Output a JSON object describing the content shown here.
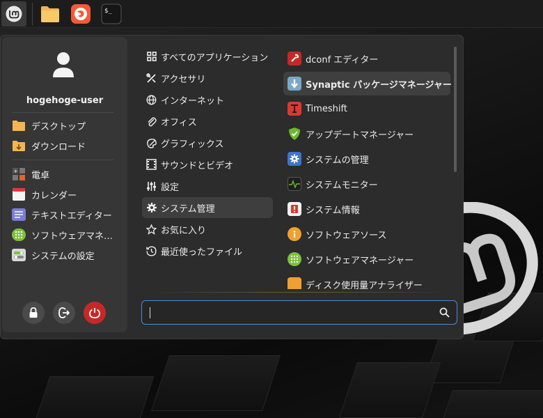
{
  "panel": {
    "launchers": [
      {
        "name": "menu-icon"
      },
      {
        "name": "files-icon"
      },
      {
        "name": "firefox-icon"
      },
      {
        "name": "terminal-icon"
      }
    ]
  },
  "sidebar": {
    "username": "hogehoge-user",
    "places": [
      {
        "label": "デスクトップ",
        "icon": "folder-icon"
      },
      {
        "label": "ダウンロード",
        "icon": "download-folder-icon"
      }
    ],
    "favorites": [
      {
        "label": "電卓",
        "icon": "calculator-icon"
      },
      {
        "label": "カレンダー",
        "icon": "calendar-icon"
      },
      {
        "label": "テキストエディター",
        "icon": "text-editor-icon"
      },
      {
        "label": "ソフトウェアマネ…",
        "icon": "software-manager-icon"
      },
      {
        "label": "システムの設定",
        "icon": "settings-icon"
      }
    ],
    "actions": [
      {
        "name": "lock-button",
        "icon": "lock-icon"
      },
      {
        "name": "logout-button",
        "icon": "logout-icon"
      },
      {
        "name": "shutdown-button",
        "icon": "power-icon",
        "color": "#c62828"
      }
    ]
  },
  "categories": [
    {
      "label": "すべてのアプリケーション",
      "icon": "grid-icon"
    },
    {
      "label": "アクセサリ",
      "icon": "tools-icon"
    },
    {
      "label": "インターネット",
      "icon": "globe-icon"
    },
    {
      "label": "オフィス",
      "icon": "paperclip-icon"
    },
    {
      "label": "グラフィックス",
      "icon": "palette-icon"
    },
    {
      "label": "サウンドとビデオ",
      "icon": "film-icon"
    },
    {
      "label": "設定",
      "icon": "sliders-icon"
    },
    {
      "label": "システム管理",
      "icon": "gear-icon",
      "selected": true
    },
    {
      "label": "お気に入り",
      "icon": "star-icon"
    },
    {
      "label": "最近使ったファイル",
      "icon": "history-icon"
    }
  ],
  "apps": [
    {
      "label": "dconf エディター",
      "icon": "dconf-icon"
    },
    {
      "label": "Synaptic パッケージマネージャー",
      "icon": "synaptic-icon",
      "highlighted": true
    },
    {
      "label": "Timeshift",
      "icon": "timeshift-icon"
    },
    {
      "label": "アップデートマネージャー",
      "icon": "update-manager-icon"
    },
    {
      "label": "システムの管理",
      "icon": "system-admin-icon"
    },
    {
      "label": "システムモニター",
      "icon": "system-monitor-icon"
    },
    {
      "label": "システム情報",
      "icon": "system-info-icon"
    },
    {
      "label": "ソフトウェアソース",
      "icon": "software-sources-icon"
    },
    {
      "label": "ソフトウェアマネージャー",
      "icon": "software-manager-icon"
    },
    {
      "label": "ディスク使用量アナライザー",
      "icon": "disk-usage-icon"
    }
  ],
  "search": {
    "value": "",
    "placeholder": ""
  },
  "colors": {
    "accent": "#4c8ad6",
    "mint": "#87cf3e"
  }
}
